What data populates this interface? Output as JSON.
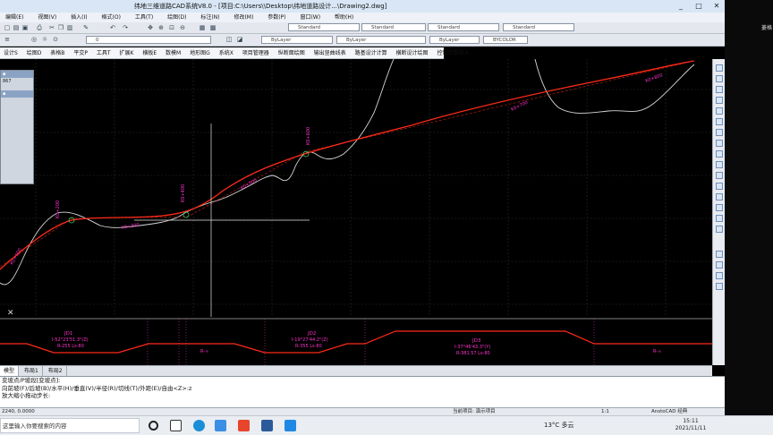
{
  "window": {
    "title": "纬地三维道路CAD系统V8.0 - [项目:C:\\Users\\\\Desktop\\纬地道路设计...\\Drawing2.dwg]",
    "controls": [
      "_",
      "□",
      "✕"
    ]
  },
  "menu": {
    "items": [
      "编辑(E)",
      "视图(V)",
      "插入(I)",
      "格式(O)",
      "工具(T)",
      "绘图(D)",
      "标注(N)",
      "修改(M)",
      "参数(P)",
      "窗口(W)",
      "帮助(H)"
    ]
  },
  "toolbar": {
    "text_style_1": "Standard",
    "text_style_2": "Standard",
    "text_style_3": "Standard",
    "layer_combo": "0",
    "color_combo": "ByLayer",
    "linetype_combo": "ByLayer",
    "lineweight_combo": "ByLayer",
    "plotstyle_combo": "BYCOLOR"
  },
  "command_strip": {
    "items": [
      "设计S",
      "绘图D",
      "表格B",
      "平交P",
      "工具T",
      "扩展K",
      "横板E",
      "数模M",
      "地形图G",
      "系统X",
      "项目管理器",
      "纵断面绘图",
      "输出竖曲线表",
      "路基设计计算",
      "横断设计绘图",
      "控制参数输入"
    ]
  },
  "side_panel": {
    "value": "867"
  },
  "drawing": {
    "station_labels": [
      {
        "text": "K0+100"
      },
      {
        "text": "K0+200"
      },
      {
        "text": "K0+300"
      },
      {
        "text": "K0+400"
      },
      {
        "text": "K0+500"
      },
      {
        "text": "K0+600"
      },
      {
        "text": "K0+700"
      },
      {
        "text": "K0+800"
      }
    ],
    "colors": {
      "design_line": "#ff2a1a",
      "ground_line": "#d8d8d8",
      "grid": "#2e3a2e",
      "label": "#ff33cc"
    }
  },
  "curve_band": {
    "curves": [
      {
        "name": "JD1",
        "angle": "I-52°23'51.3\"(Z)",
        "params": "R-255  Ls-80"
      },
      {
        "name": "JD2",
        "angle": "I-19°27'44.2\"(Z)",
        "params": "R-355  Ls-80"
      },
      {
        "name": "JD3",
        "angle": "I-37°46'43.3\"(Y)",
        "params": "R-381.57  Ls-80"
      }
    ],
    "r_inf": "R-∞"
  },
  "layout_tabs": [
    "模型",
    "布局1",
    "布局2"
  ],
  "command_line": {
    "lines": [
      "变坡点/P坡段[变坡点]:",
      "向前坡(F)/后坡(B)/水平(H)/垂直(V)/半径(R)/切线(T)/外距(E)/自由<Z>:z",
      "放大缩小拖动步长:"
    ]
  },
  "status": {
    "coords": "2240, 0.0000",
    "project": "当前项目: 演示项目",
    "scale": "1:1",
    "app": "AnstoCAD 经典"
  },
  "right_snippet": "菱格",
  "taskbar": {
    "search_placeholder": "这里输入你要搜索的内容",
    "weather": "13°C 多云",
    "time": "15:11",
    "date": "2021/11/11"
  }
}
